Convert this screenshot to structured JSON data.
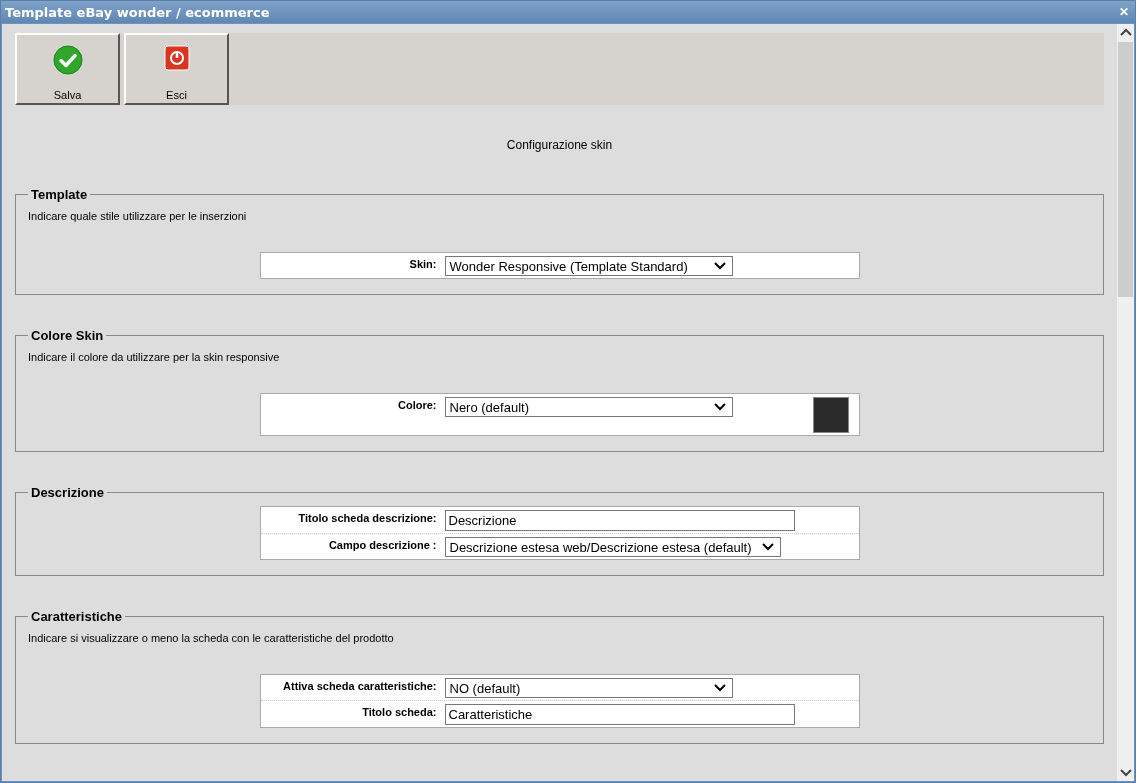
{
  "window": {
    "title": "Template eBay wonder / ecommerce",
    "close": "✕"
  },
  "toolbar": [
    {
      "label": "Salva",
      "kind": "save"
    },
    {
      "label": "Esci",
      "kind": "exit"
    }
  ],
  "page_title": "Configurazione skin",
  "sections": [
    {
      "legend": "Template",
      "description": "Indicare quale stile utilizzare per le inserzioni",
      "fields": [
        {
          "label": "Skin:",
          "kind": "select",
          "value": "Wonder Responsive (Template Standard)"
        }
      ]
    },
    {
      "legend": "Colore Skin",
      "description": "Indicare il colore da utilizzare per la skin responsive",
      "fields": [
        {
          "label": "Colore:",
          "kind": "select",
          "value": "Nero (default)",
          "color": "#2b2b2b"
        }
      ]
    },
    {
      "legend": "Descrizione",
      "fields": [
        {
          "label": "Titolo scheda descrizione:",
          "kind": "text",
          "value": "Descrizione"
        },
        {
          "label": "Campo descrizione :",
          "kind": "select",
          "value": "Descrizione estesa web/Descrizione estesa (default)"
        }
      ]
    },
    {
      "legend": "Caratteristiche",
      "description": "Indicare si visualizzare o meno la scheda con le caratteristiche del prodotto",
      "fields": [
        {
          "label": "Attiva scheda caratteristiche:",
          "kind": "select",
          "value": "NO (default)"
        },
        {
          "label": "Titolo scheda:",
          "kind": "text",
          "value": "Caratteristiche"
        }
      ]
    }
  ]
}
